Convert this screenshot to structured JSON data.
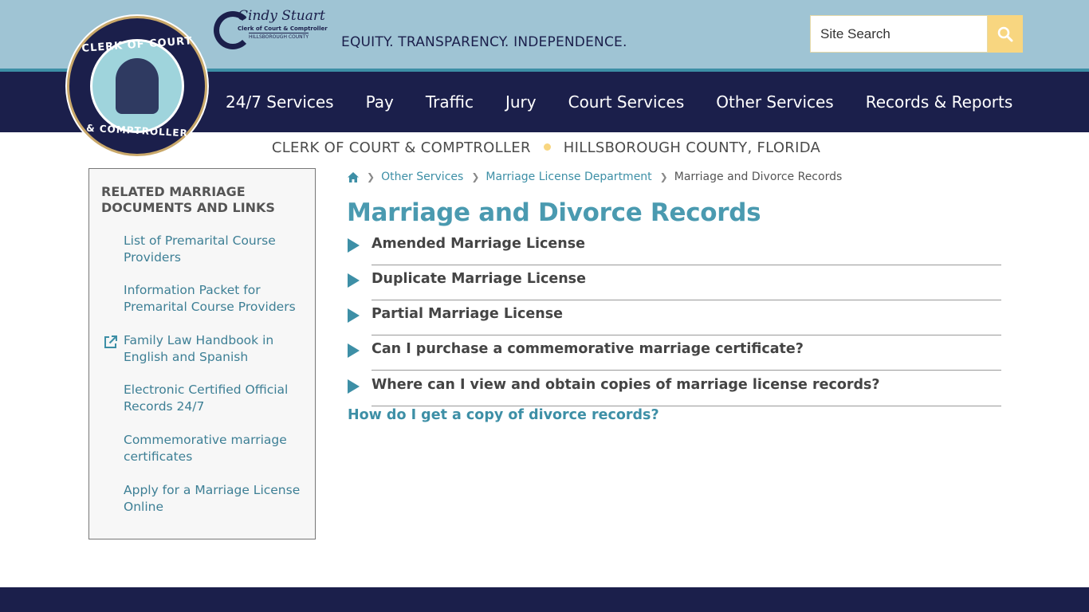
{
  "header": {
    "seal_top_text": "CLERK OF COURT",
    "seal_bottom_text": "& COMPTROLLER",
    "brand_name": "Cindy Stuart",
    "brand_sub": "Clerk of Court & Comptroller",
    "brand_sub2": "HILLSBOROUGH COUNTY",
    "tagline": "EQUITY. TRANSPARENCY. INDEPENDENCE.",
    "search_placeholder": "Site Search"
  },
  "nav": {
    "items": [
      "24/7 Services",
      "Pay",
      "Traffic",
      "Jury",
      "Court Services",
      "Other Services",
      "Records & Reports"
    ]
  },
  "subheader": {
    "left": "CLERK OF COURT & COMPTROLLER",
    "right": "HILLSBOROUGH COUNTY, FLORIDA"
  },
  "sidebar": {
    "title": "RELATED MARRIAGE DOCUMENTS AND LINKS",
    "links": [
      "List of Premarital Course Providers",
      "Information Packet for Premarital Course Providers",
      "Family Law Handbook in English and Spanish",
      "Electronic Certified Official Records 24/7",
      "Commemorative marriage certificates",
      "Apply for a Marriage License Online"
    ]
  },
  "breadcrumb": {
    "items": [
      "Other Services",
      "Marriage License Department"
    ],
    "current": "Marriage and Divorce Records"
  },
  "main": {
    "title": "Marriage and Divorce Records",
    "accordion": [
      "Amended Marriage License",
      "Duplicate Marriage License",
      "Partial Marriage License",
      "Can I purchase a commemorative marriage certificate?",
      "Where can I view and obtain copies of marriage license records?"
    ],
    "divorce_link": "How do I get a copy of divorce records?"
  },
  "colors": {
    "navy": "#1b1f4b",
    "sky": "#9fc4d4",
    "teal": "#3d8fa6",
    "gold": "#f8d680"
  },
  "icons": {
    "home": "home-icon",
    "search": "search-icon",
    "external": "external-link-icon",
    "expand": "triangle-right-icon"
  }
}
